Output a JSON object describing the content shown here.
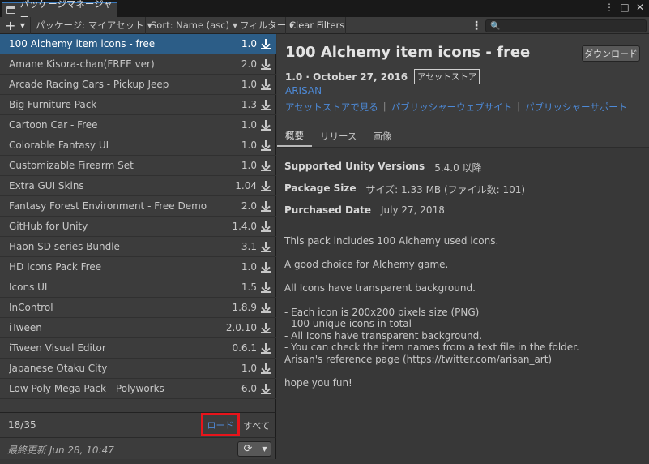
{
  "window": {
    "tab_title": "パッケージマネージャー",
    "controls": [
      "⋮",
      "□",
      "✕"
    ]
  },
  "toolbar": {
    "add_label": "+",
    "package_source": "パッケージ: マイアセット",
    "sort": "Sort: Name (asc)",
    "filter": "フィルター",
    "clear_filters": "Clear Filters",
    "search_placeholder": "🔍"
  },
  "packages": [
    {
      "name": "100 Alchemy item icons - free",
      "version": "1.0",
      "selected": true
    },
    {
      "name": "Amane Kisora-chan(FREE ver)",
      "version": "2.0"
    },
    {
      "name": "Arcade Racing Cars - Pickup Jeep",
      "version": "1.0"
    },
    {
      "name": "Big Furniture Pack",
      "version": "1.3"
    },
    {
      "name": "Cartoon Car - Free",
      "version": "1.0"
    },
    {
      "name": "Colorable Fantasy UI",
      "version": "1.0"
    },
    {
      "name": "Customizable Firearm Set",
      "version": "1.0"
    },
    {
      "name": "Extra GUI Skins",
      "version": "1.04"
    },
    {
      "name": "Fantasy Forest Environment - Free Demo",
      "version": "2.0"
    },
    {
      "name": "GitHub for Unity",
      "version": "1.4.0"
    },
    {
      "name": "Haon SD series Bundle",
      "version": "3.1"
    },
    {
      "name": "HD Icons Pack Free",
      "version": "1.0"
    },
    {
      "name": "Icons UI",
      "version": "1.5"
    },
    {
      "name": "InControl",
      "version": "1.8.9"
    },
    {
      "name": "iTween",
      "version": "2.0.10"
    },
    {
      "name": "iTween Visual Editor",
      "version": "0.6.1"
    },
    {
      "name": "Japanese Otaku City",
      "version": "1.0"
    },
    {
      "name": "Low Poly Mega Pack - Polyworks",
      "version": "6.0"
    }
  ],
  "footer": {
    "count": "18/35",
    "load": "ロード",
    "all": "すべて",
    "last_updated": "最終更新  Jun 28, 10:47"
  },
  "detail": {
    "title": "100 Alchemy item icons - free",
    "download_button": "ダウンロード",
    "version_date": "1.0 · October 27, 2016",
    "store_badge": "アセットストア",
    "author": "ARISAN",
    "links": [
      "アセットストアで見る",
      "パブリッシャーウェブサイト",
      "パブリッシャーサポート"
    ],
    "tabs": [
      "概要",
      "リリース",
      "画像"
    ],
    "supported_label": "Supported Unity Versions",
    "supported_value": "5.4.0 以降",
    "size_label": "Package Size",
    "size_value": "サイズ: 1.33 MB (ファイル数: 101)",
    "purchased_label": "Purchased Date",
    "purchased_value": "July 27, 2018",
    "description": [
      "This pack includes 100 Alchemy used icons.",
      "",
      "A good choice for Alchemy game.",
      "",
      "All Icons have transparent background.",
      "",
      "- Each icon is 200x200 pixels size (PNG)",
      "- 100 unique icons in total",
      "- All Icons have transparent background.",
      "- You can check the item names from a text file in the folder.",
      "Arisan's reference page (https://twitter.com/arisan_art)",
      "",
      "hope you fun!"
    ]
  },
  "colors": {
    "selection": "#2c5d87",
    "link": "#4d8ad8",
    "highlight_box": "#e8141b"
  }
}
